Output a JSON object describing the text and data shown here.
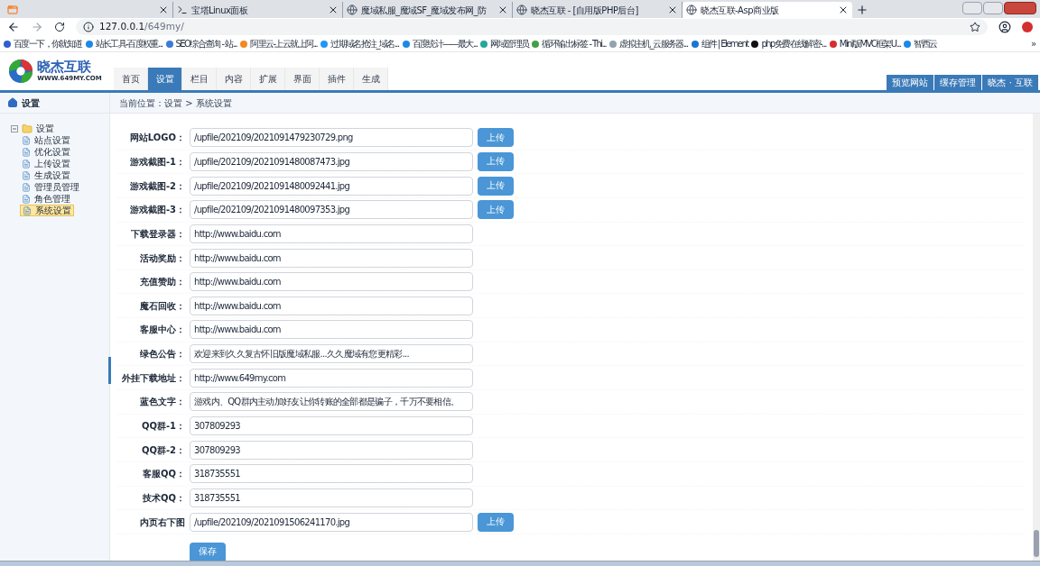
{
  "browser": {
    "tabs": [
      {
        "selected": false
      },
      {
        "title": "宝塔Linux面板",
        "selected": false
      },
      {
        "title": "魔域私服_魔域SF_魔域发布网_防",
        "selected": false
      },
      {
        "title": "晓杰互联 - [自用版PHP后台]",
        "selected": false
      },
      {
        "title": "晓杰互联-Asp商业版",
        "selected": true
      }
    ],
    "address": {
      "host": "127.0.0.1",
      "path": "/649my/"
    },
    "bookmarks": [
      "百度一下，你就知道",
      "站长工具-百度权重...",
      "SEO综合查询 - 站...",
      "阿里云-上云就上阿...",
      "过期域名抢注_域名...",
      "百度统计——最大...",
      "网域管理员",
      "循环输出标签 - Thi...",
      "虚拟主机_云服务器...",
      "组件 | Element",
      "php免费在线解密-...",
      "Mini版MVC框架U...",
      "智西云"
    ],
    "more": "»"
  },
  "header": {
    "logo_name": "晓杰互联",
    "logo_domain": "WWW.649MY.COM",
    "nav": [
      {
        "label": "首页",
        "selected": false
      },
      {
        "label": "设置",
        "selected": true
      },
      {
        "label": "栏目",
        "selected": false
      },
      {
        "label": "内容",
        "selected": false
      },
      {
        "label": "扩展",
        "selected": false
      },
      {
        "label": "界面",
        "selected": false
      },
      {
        "label": "插件",
        "selected": false
      },
      {
        "label": "生成",
        "selected": false
      }
    ],
    "top_links": [
      "预览网站",
      "缓存管理",
      "晓杰 · 互联"
    ]
  },
  "sidebar": {
    "title": "设置",
    "tree": {
      "label": "设置",
      "expanded": true,
      "children": [
        {
          "label": "站点设置",
          "selected": false
        },
        {
          "label": "优化设置",
          "selected": false
        },
        {
          "label": "上传设置",
          "selected": false
        },
        {
          "label": "生成设置",
          "selected": false
        },
        {
          "label": "管理员管理",
          "selected": false
        },
        {
          "label": "角色管理",
          "selected": false
        },
        {
          "label": "系统设置",
          "selected": true
        }
      ]
    }
  },
  "breadcrumb": "当前位置：设置 > 系统设置",
  "form": {
    "rows": [
      {
        "label": "网站LOGO：",
        "value": "/upfile/202109/2021091479230729.png",
        "kind": "upload",
        "button": "上传"
      },
      {
        "label": "游戏截图-1：",
        "value": "/upfile/202109/2021091480087473.jpg",
        "kind": "upload",
        "button": "上传"
      },
      {
        "label": "游戏截图-2：",
        "value": "/upfile/202109/2021091480092441.jpg",
        "kind": "upload",
        "button": "上传"
      },
      {
        "label": "游戏截图-3：",
        "value": "/upfile/202109/2021091480097353.jpg",
        "kind": "upload",
        "button": "上传"
      },
      {
        "label": "下载登录器：",
        "value": "http://www.baidu.com",
        "kind": "text"
      },
      {
        "label": "活动奖励：",
        "value": "http://www.baidu.com",
        "kind": "text"
      },
      {
        "label": "充值赞助：",
        "value": "http://www.baidu.com",
        "kind": "text"
      },
      {
        "label": "魔石回收：",
        "value": "http://www.baidu.com",
        "kind": "text"
      },
      {
        "label": "客服中心：",
        "value": "http://www.baidu.com",
        "kind": "text"
      },
      {
        "label": "绿色公告：",
        "value": "欢迎来到久久复古怀旧版魔域私服...久久魔域有您更精彩...",
        "kind": "text"
      },
      {
        "label": "外挂下载地址：",
        "value": "http://www.649my.com",
        "kind": "text"
      },
      {
        "label": "蓝色文字：",
        "value": "游戏内、QQ群内主动加好友让你转账的全部都是骗子，千万不要相信。",
        "kind": "text"
      },
      {
        "label": "QQ群-1：",
        "value": "307809293",
        "kind": "text"
      },
      {
        "label": "QQ群-2：",
        "value": "307809293",
        "kind": "text"
      },
      {
        "label": "客服QQ：",
        "value": "318735551",
        "kind": "text"
      },
      {
        "label": "技术QQ：",
        "value": "318735551",
        "kind": "text"
      },
      {
        "label": "内页右下图",
        "value": "/upfile/202109/2021091506241170.jpg",
        "kind": "upload",
        "button": "上传"
      }
    ],
    "save_button": "保存"
  }
}
